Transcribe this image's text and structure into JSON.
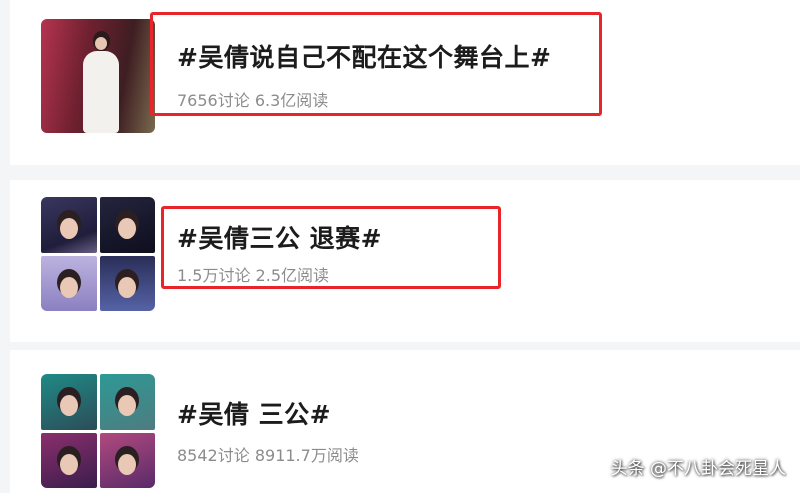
{
  "topics": [
    {
      "title": "#吴倩说自己不配在这个舞台上#",
      "discussions": "7656讨论",
      "reads": "6.3亿阅读",
      "highlighted": true
    },
    {
      "title": "#吴倩三公 退赛#",
      "discussions": "1.5万讨论",
      "reads": "2.5亿阅读",
      "highlighted": true
    },
    {
      "title": "#吴倩 三公#",
      "discussions": "8542讨论",
      "reads": "8911.7万阅读",
      "highlighted": false
    }
  ],
  "watermark": "头条 @不八卦会死星人",
  "colors": {
    "highlight_border": "#e8252b",
    "title_text": "#1c1c1c",
    "meta_text": "#8c8c8c",
    "page_background": "#f4f5f7",
    "card_background": "#ffffff"
  }
}
